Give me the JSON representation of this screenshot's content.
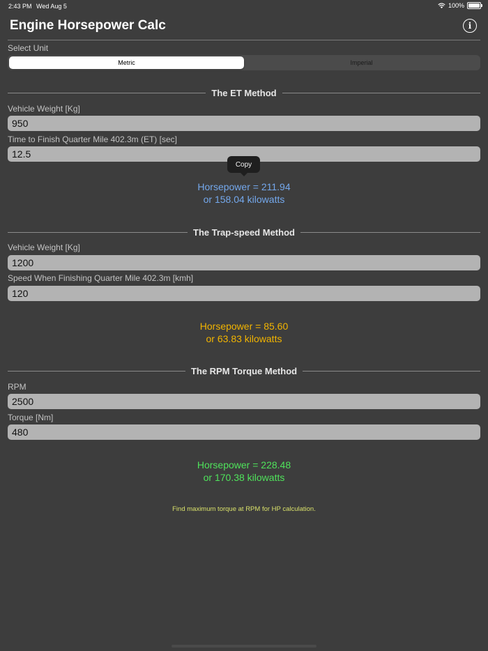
{
  "status_bar": {
    "time": "2:43 PM",
    "date": "Wed Aug 5",
    "battery": "100%",
    "wifi_icon": "wifi-icon",
    "battery_icon": "battery-icon"
  },
  "header": {
    "title": "Engine Horsepower Calc",
    "info_icon": "info-icon",
    "info_glyph": "i"
  },
  "unit_selector": {
    "label": "Select Unit",
    "options": [
      "Metric",
      "Imperial"
    ],
    "selected": "Metric"
  },
  "et_method": {
    "title": "The ET Method",
    "weight_label": "Vehicle Weight [Kg]",
    "weight_value": "950",
    "time_label": "Time to Finish Quarter Mile 402.3m (ET) [sec]",
    "time_value": "12.5",
    "copy_tooltip": "Copy",
    "result_hp": "Horsepower = 211.94",
    "result_kw": "or 158.04 kilowatts"
  },
  "trap_method": {
    "title": "The Trap-speed Method",
    "weight_label": "Vehicle Weight [Kg]",
    "weight_value": "1200",
    "speed_label": "Speed When Finishing Quarter Mile 402.3m [kmh]",
    "speed_value": "120",
    "result_hp": "Horsepower = 85.60",
    "result_kw": "or 63.83 kilowatts"
  },
  "rpm_method": {
    "title": "The RPM Torque Method",
    "rpm_label": "RPM",
    "rpm_value": "2500",
    "torque_label": "Torque [Nm]",
    "torque_value": "480",
    "result_hp": "Horsepower = 228.48",
    "result_kw": "or 170.38 kilowatts"
  },
  "footnote": "Find maximum torque at RPM for HP calculation.",
  "colors": {
    "background": "#3d3d3d",
    "et_result": "#74a8ec",
    "trap_result": "#f2b400",
    "rpm_result": "#4fe35b",
    "footnote": "#d8e06a"
  }
}
